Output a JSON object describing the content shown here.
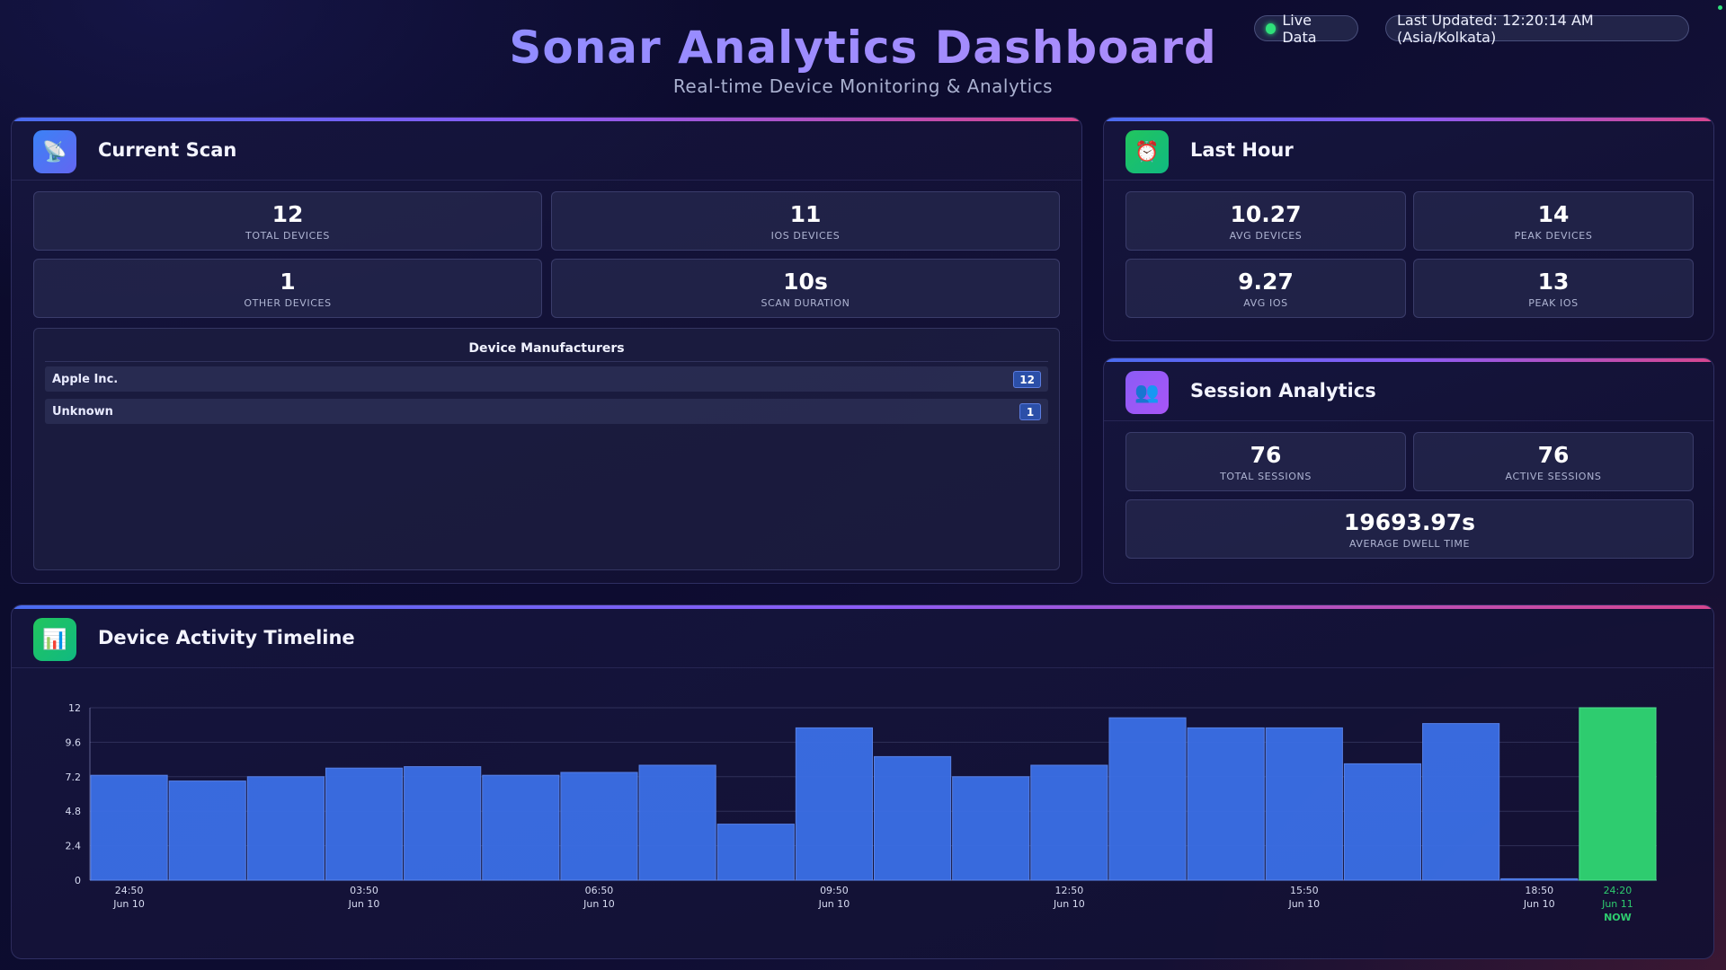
{
  "header": {
    "title": "Sonar Analytics Dashboard",
    "subtitle": "Real-time Device Monitoring & Analytics",
    "live_label": "Live Data",
    "last_updated": "Last Updated: 12:20:14 AM (Asia/Kolkata)"
  },
  "current_scan": {
    "title": "Current Scan",
    "icon": "satellite-dish-icon",
    "stats": [
      {
        "value": "12",
        "label": "Total Devices"
      },
      {
        "value": "11",
        "label": "iOS Devices"
      },
      {
        "value": "1",
        "label": "Other Devices"
      },
      {
        "value": "10s",
        "label": "Scan Duration"
      }
    ],
    "manufacturers_title": "Device Manufacturers",
    "manufacturers": [
      {
        "name": "Apple Inc.",
        "count": "12"
      },
      {
        "name": "Unknown",
        "count": "1"
      }
    ]
  },
  "last_hour": {
    "title": "Last Hour",
    "icon": "alarm-clock-icon",
    "stats": [
      {
        "value": "10.27",
        "label": "Avg Devices"
      },
      {
        "value": "14",
        "label": "Peak Devices"
      },
      {
        "value": "9.27",
        "label": "Avg iOS"
      },
      {
        "value": "13",
        "label": "Peak iOS"
      }
    ]
  },
  "session_analytics": {
    "title": "Session Analytics",
    "icon": "users-icon",
    "stats": [
      {
        "value": "76",
        "label": "Total Sessions"
      },
      {
        "value": "76",
        "label": "Active Sessions"
      },
      {
        "value": "19693.97s",
        "label": "Average Dwell Time"
      }
    ]
  },
  "timeline": {
    "title": "Device Activity Timeline",
    "icon": "bar-chart-icon"
  },
  "chart_data": {
    "type": "bar",
    "title": "",
    "xlabel": "",
    "ylabel": "",
    "ylim": [
      0,
      12
    ],
    "yticks": [
      "0",
      "2.4",
      "4.8",
      "7.2",
      "9.6",
      "12"
    ],
    "values": [
      7.3,
      6.9,
      7.2,
      7.8,
      7.9,
      7.3,
      7.5,
      8.0,
      3.9,
      10.6,
      8.6,
      7.2,
      8.0,
      11.3,
      10.6,
      10.6,
      8.1,
      10.9,
      0.1,
      12.0
    ],
    "x_ticks": [
      {
        "bar": 0,
        "time": "24:50",
        "date": "Jun 10"
      },
      {
        "bar": 3,
        "time": "03:50",
        "date": "Jun 10"
      },
      {
        "bar": 6,
        "time": "06:50",
        "date": "Jun 10"
      },
      {
        "bar": 9,
        "time": "09:50",
        "date": "Jun 10"
      },
      {
        "bar": 12,
        "time": "12:50",
        "date": "Jun 10"
      },
      {
        "bar": 15,
        "time": "15:50",
        "date": "Jun 10"
      },
      {
        "bar": 18,
        "time": "18:50",
        "date": "Jun 10"
      },
      {
        "bar": 19,
        "time": "24:20",
        "date": "Jun 11",
        "tag": "NOW"
      }
    ],
    "highlight_bar": 19,
    "bar_color": "#3b6fe6",
    "highlight_color": "#2ecc6f",
    "grid": true,
    "legend": "none"
  }
}
